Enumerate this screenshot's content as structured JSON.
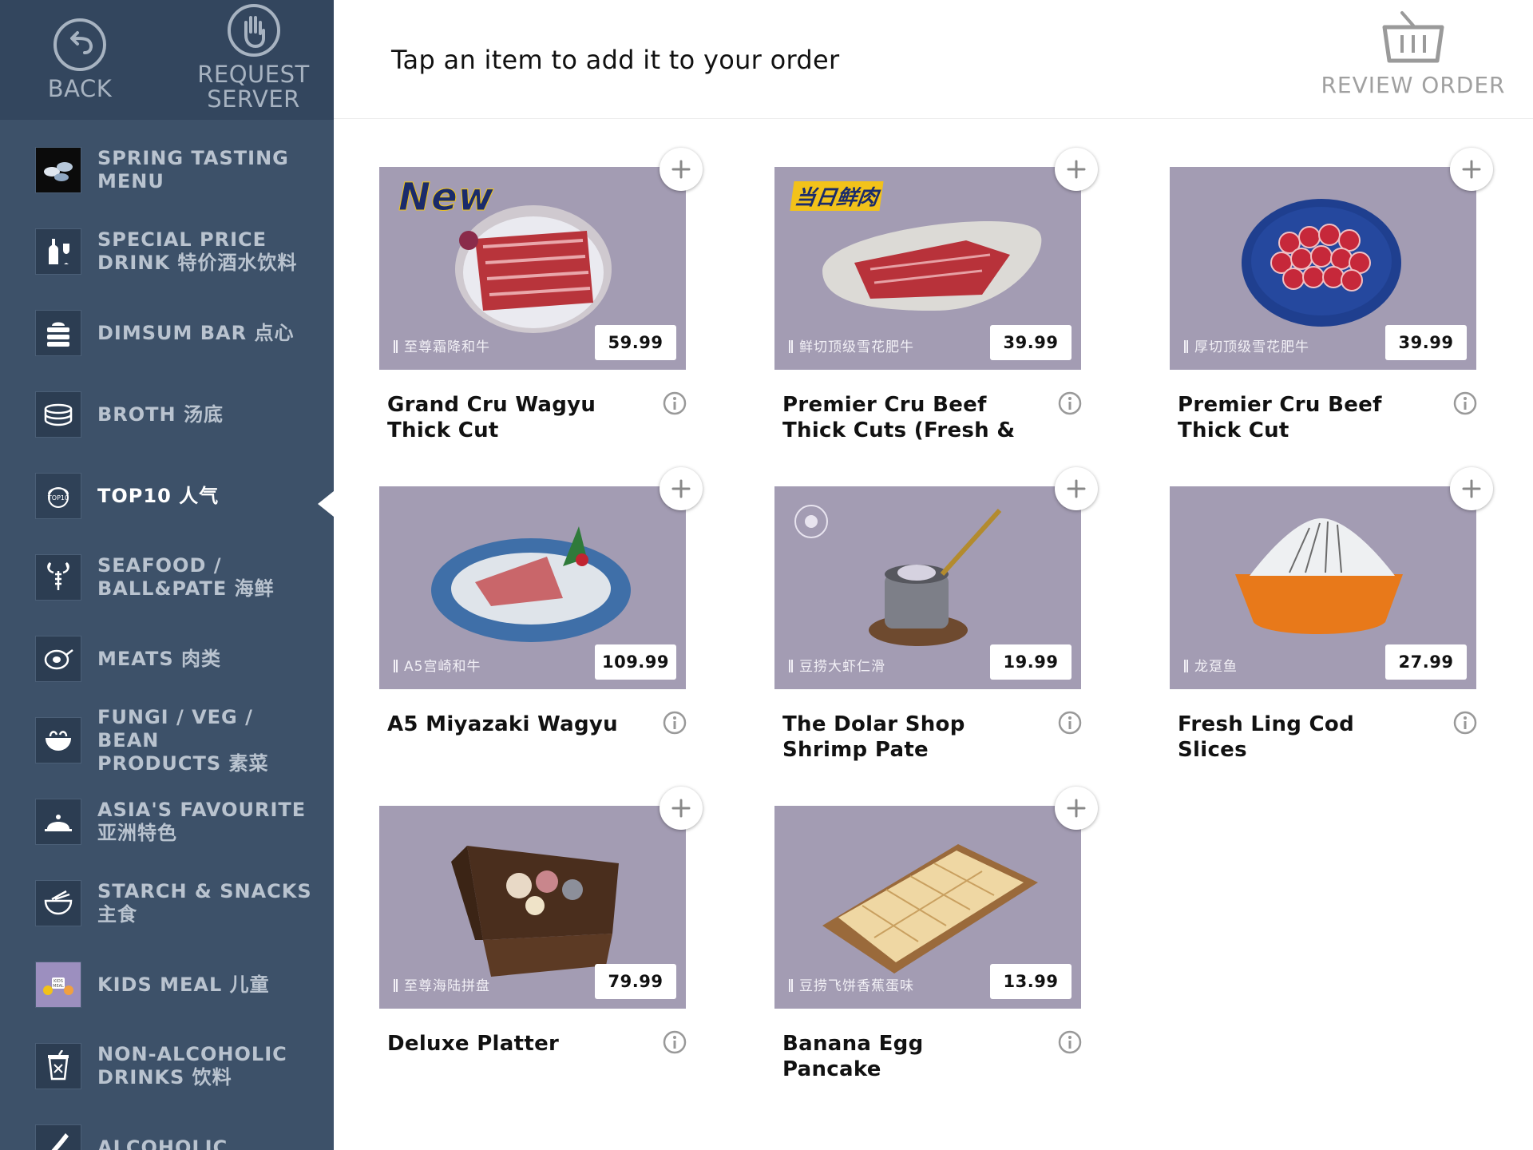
{
  "topbar": {
    "back_label": "BACK",
    "request_label_1": "REQUEST",
    "request_label_2": "SERVER"
  },
  "header": {
    "title": "Tap an item to add it to your order",
    "review_label": "REVIEW ORDER"
  },
  "sidebar": {
    "items": [
      {
        "label": "SPRING TASTING\nMENU",
        "icon": "tasting-menu-icon"
      },
      {
        "label": "SPECIAL PRICE\nDRINK 特价酒水饮料",
        "icon": "wine-bottle-icon"
      },
      {
        "label": "DIMSUM BAR 点心",
        "icon": "dimsum-icon"
      },
      {
        "label": "BROTH 汤底",
        "icon": "broth-pot-icon"
      },
      {
        "label": "TOP10 人气",
        "icon": "top10-icon",
        "active": true
      },
      {
        "label": "SEAFOOD /\nBALL&PATE 海鲜",
        "icon": "lobster-icon"
      },
      {
        "label": "MEATS 肉类",
        "icon": "meat-icon"
      },
      {
        "label": "FUNGI / VEG / BEAN\nPRODUCTS 素菜",
        "icon": "vegetable-bowl-icon"
      },
      {
        "label": "ASIA'S FAVOURITE\n亚洲特色",
        "icon": "cloche-icon"
      },
      {
        "label": "STARCH & SNACKS\n主食",
        "icon": "noodle-bowl-icon"
      },
      {
        "label": "KIDS MEAL 儿童",
        "icon": "kids-meal-icon"
      },
      {
        "label": "NON-ALCOHOLIC\nDRINKS 饮料",
        "icon": "cup-icon"
      },
      {
        "label": "ALCOHOLIC",
        "icon": "bottle-icon"
      }
    ]
  },
  "menu_items": [
    {
      "name": "Grand Cru Wagyu\nThick Cut",
      "cn": "至尊霜降和牛",
      "price": "59.99",
      "badge": "New",
      "dish": "wagyu-plate"
    },
    {
      "name": "Premier Cru Beef\nThick Cuts (Fresh &",
      "cn": "鲜切顶级雪花肥牛",
      "price": "39.99",
      "badge": "当日鲜肉",
      "dish": "beef-dish"
    },
    {
      "name": "Premier Cru Beef\nThick Cut",
      "cn": "厚切顶级雪花肥牛",
      "price": "39.99",
      "badge": "",
      "dish": "beef-rolls"
    },
    {
      "name": "A5 Miyazaki Wagyu",
      "cn": "A5宫崎和牛",
      "price": "109.99",
      "badge": "",
      "dish": "wagyu-shell"
    },
    {
      "name": "The Dolar Shop\nShrimp Pate",
      "cn": "豆捞大虾仁滑",
      "price": "19.99",
      "badge": "",
      "dish": "shrimp-pot"
    },
    {
      "name": "Fresh Ling Cod Slices",
      "cn": "龙趸鱼",
      "price": "27.99",
      "badge": "",
      "dish": "fish-bowl"
    },
    {
      "name": "Deluxe Platter",
      "cn": "至尊海陆拼盘",
      "price": "79.99",
      "badge": "",
      "dish": "platter-box"
    },
    {
      "name": "Banana Egg Pancake",
      "cn": "豆捞飞饼香蕉蛋味",
      "price": "13.99",
      "badge": "",
      "dish": "pancake-board"
    }
  ],
  "colors": {
    "sidebar_bg": "#3d5169",
    "topbar_bg": "#33465e",
    "photo_bg": "#a39cb3"
  }
}
